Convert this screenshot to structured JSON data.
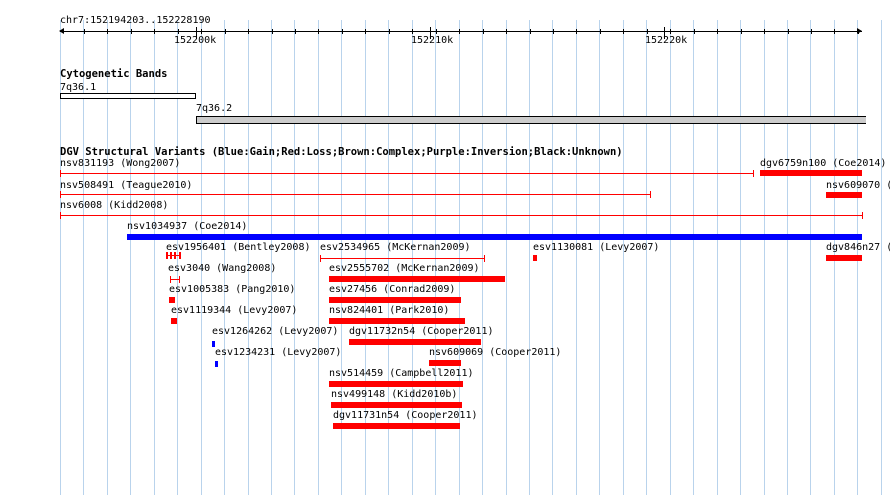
{
  "ruler": {
    "location": "chr7:152194203..152228190",
    "major_labels": [
      "152200k",
      "152210k",
      "152220k"
    ]
  },
  "cytoband": {
    "title": "Cytogenetic Bands",
    "bands": [
      {
        "label": "7q36.1",
        "fill": "#ffffff"
      },
      {
        "label": "7q36.2",
        "fill": "#cccccc"
      }
    ]
  },
  "dgv": {
    "title": "DGV Structural Variants (Blue:Gain;Red:Loss;Brown:Complex;Purple:Inversion;Black:Unknown)",
    "colors": {
      "gain": "#0000ff",
      "loss": "#ff0000"
    },
    "features": [
      {
        "label": "nsv831193 (Wong2007)",
        "type": "loss",
        "style": "line"
      },
      {
        "label": "dgv6759n100 (Coe2014)",
        "type": "loss",
        "style": "bar"
      },
      {
        "label": "nsv508491 (Teague2010)",
        "type": "loss",
        "style": "line"
      },
      {
        "label": "nsv609070 (C",
        "type": "loss",
        "style": "bar"
      },
      {
        "label": "nsv6008 (Kidd2008)",
        "type": "loss",
        "style": "line"
      },
      {
        "label": "nsv1034937 (Coe2014)",
        "type": "gain",
        "style": "bar"
      },
      {
        "label": "esv1956401 (Bentley2008)",
        "type": "loss",
        "style": "segments"
      },
      {
        "label": "esv2534965 (McKernan2009)",
        "type": "loss",
        "style": "line"
      },
      {
        "label": "esv1130081 (Levy2007)",
        "type": "loss",
        "style": "bar"
      },
      {
        "label": "dgv846n27 (",
        "type": "loss",
        "style": "bar"
      },
      {
        "label": "esv3040 (Wang2008)",
        "type": "loss",
        "style": "line"
      },
      {
        "label": "esv2555702 (McKernan2009)",
        "type": "loss",
        "style": "bar"
      },
      {
        "label": "esv1005383 (Pang2010)",
        "type": "loss",
        "style": "bar"
      },
      {
        "label": "esv27456 (Conrad2009)",
        "type": "loss",
        "style": "bar"
      },
      {
        "label": "esv1119344 (Levy2007)",
        "type": "loss",
        "style": "bar"
      },
      {
        "label": "nsv824401 (Park2010)",
        "type": "loss",
        "style": "bar"
      },
      {
        "label": "esv1264262 (Levy2007)",
        "type": "gain",
        "style": "bar"
      },
      {
        "label": "dgv11732n54 (Cooper2011)",
        "type": "loss",
        "style": "bar"
      },
      {
        "label": "esv1234231 (Levy2007)",
        "type": "gain",
        "style": "bar"
      },
      {
        "label": "nsv609069 (Cooper2011)",
        "type": "loss",
        "style": "bar"
      },
      {
        "label": "nsv514459 (Campbell2011)",
        "type": "loss",
        "style": "bar"
      },
      {
        "label": "nsv499148 (Kidd2010b)",
        "type": "loss",
        "style": "bar"
      },
      {
        "label": "dgv11731n54 (Cooper2011)",
        "type": "loss",
        "style": "bar"
      }
    ]
  }
}
